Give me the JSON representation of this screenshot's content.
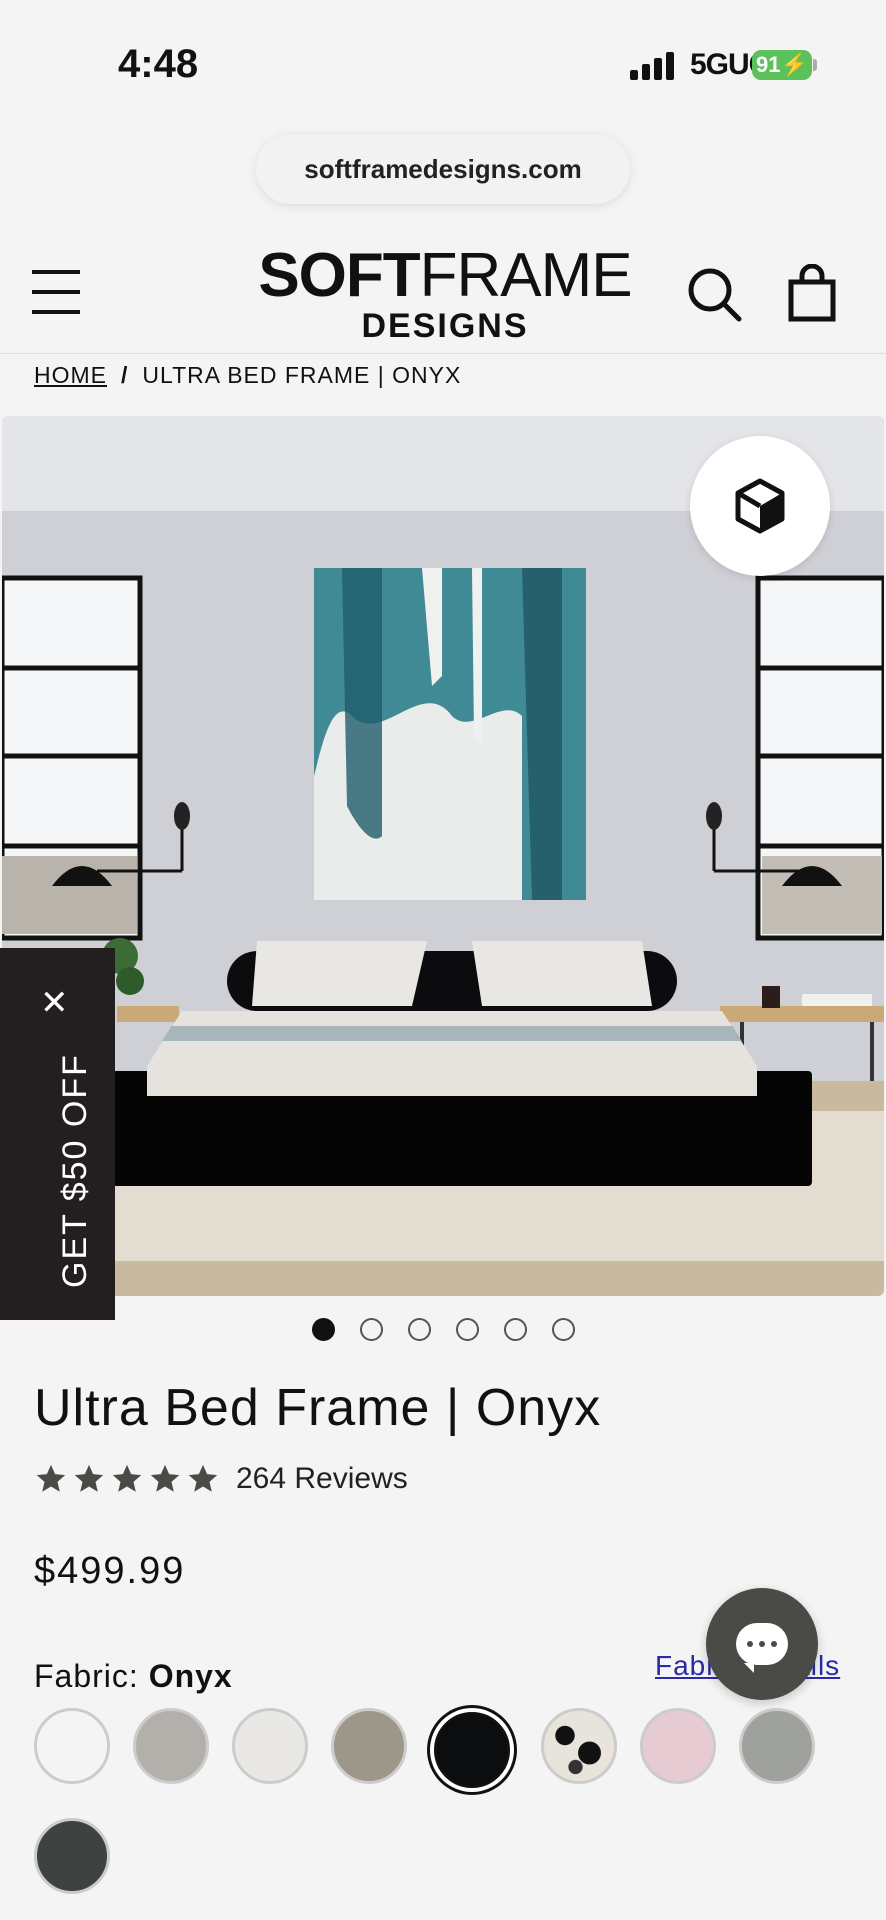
{
  "status": {
    "time": "4:48",
    "network": "5GUC",
    "battery": "91"
  },
  "browser": {
    "url": "softframedesigns.com"
  },
  "header": {
    "logo_line1_bold": "SOFT",
    "logo_line1_light": "FRAME",
    "logo_line2": "DESIGNS"
  },
  "breadcrumb": {
    "home": "HOME",
    "separator": "/",
    "current": "ULTRA BED FRAME | ONYX"
  },
  "promo": {
    "text": "GET $50 OFF",
    "close": "✕"
  },
  "gallery": {
    "dots": 6,
    "active_dot": 1
  },
  "product": {
    "title": "Ultra Bed Frame | Onyx",
    "rating": 5,
    "reviews": "264 Reviews",
    "price": "$499.99"
  },
  "fabric": {
    "label": "Fabric:",
    "selected": "Onyx",
    "details_link": "Fabric Details",
    "swatch_colors": [
      "#f4f4f4",
      "#b3b0ab",
      "#e9e8e5",
      "#9d978a",
      "#0c0d0f",
      "#e8e4dc",
      "#e6cbd3",
      "#9fa19d",
      "#3e4241"
    ],
    "selected_index": 4
  },
  "colors": {
    "accent": "#231f20",
    "link": "#2a2aa8",
    "chat": "#4a4a46"
  }
}
